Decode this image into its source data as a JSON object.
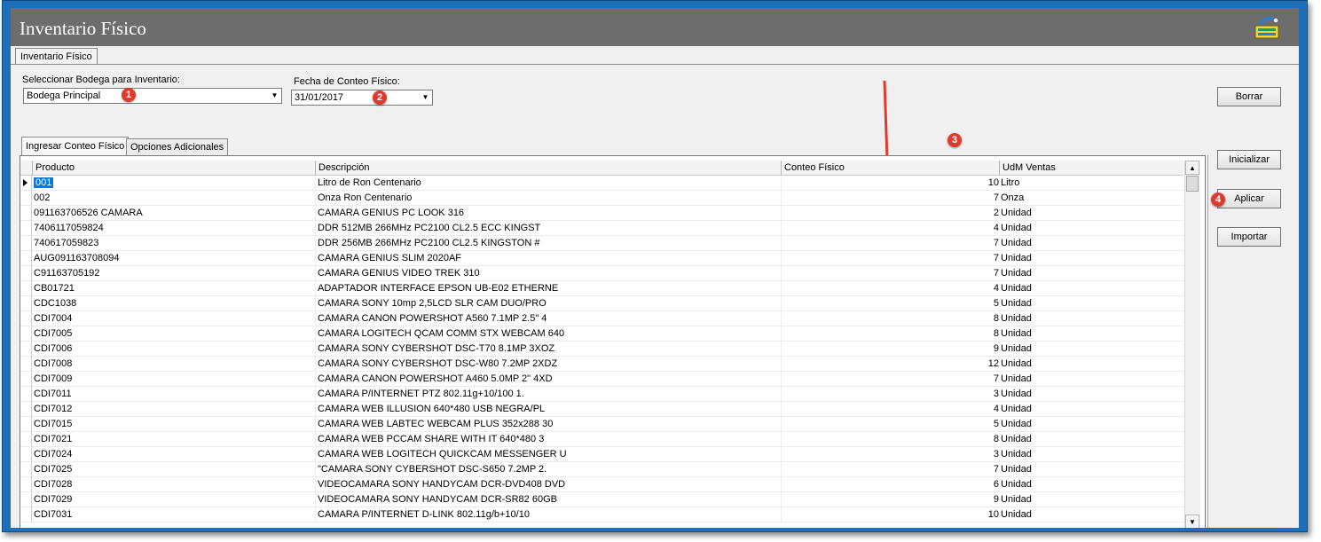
{
  "window": {
    "title": "Inventario Físico"
  },
  "top_tab": {
    "label": "Inventario Físico"
  },
  "warehouse": {
    "label": "Seleccionar Bodega para Inventario:",
    "value": "Bodega Principal"
  },
  "count_date": {
    "label": "Fecha de Conteo Físico:",
    "value": "31/01/2017"
  },
  "buttons": {
    "borrar": "Borrar",
    "inicializar": "Inicializar",
    "aplicar": "Aplicar",
    "importar": "Importar"
  },
  "sub_tabs": [
    {
      "label": "Ingresar Conteo Físico"
    },
    {
      "label": "Opciones Adicionales"
    }
  ],
  "badges": {
    "b1": "1",
    "b2": "2",
    "b3": "3",
    "b4": "4"
  },
  "grid": {
    "columns": {
      "producto": "Producto",
      "descripcion": "Descripción",
      "conteo": "Conteo Físico",
      "udm": "UdM Ventas"
    },
    "rows": [
      {
        "producto": "001",
        "descripcion": "Litro de Ron Centenario",
        "conteo": "10",
        "udm": "Litro"
      },
      {
        "producto": "002",
        "descripcion": "Onza Ron Centenario",
        "conteo": "7",
        "udm": "Onza"
      },
      {
        "producto": "091163706526 CAMARA",
        "descripcion": "CAMARA GENIUS PC LOOK 316",
        "conteo": "2",
        "udm": "Unidad"
      },
      {
        "producto": "7406117059824",
        "descripcion": "DDR 512MB 266MHz PC2100 CL2.5 ECC KINGST",
        "conteo": "4",
        "udm": "Unidad"
      },
      {
        "producto": "740617059823",
        "descripcion": "DDR 256MB 266MHz PC2100 CL2.5 KINGSTON #",
        "conteo": "7",
        "udm": "Unidad"
      },
      {
        "producto": "AUG091163708094",
        "descripcion": "CAMARA GENIUS SLIM 2020AF",
        "conteo": "7",
        "udm": "Unidad"
      },
      {
        "producto": "C91163705192",
        "descripcion": "CAMARA GENIUS VIDEO TREK 310",
        "conteo": "7",
        "udm": "Unidad"
      },
      {
        "producto": "CB01721",
        "descripcion": "ADAPTADOR INTERFACE EPSON UB-E02 ETHERNE",
        "conteo": "4",
        "udm": "Unidad"
      },
      {
        "producto": "CDC1038",
        "descripcion": "CAMARA SONY 10mp 2,5LCD SLR CAM DUO/PRO",
        "conteo": "5",
        "udm": "Unidad"
      },
      {
        "producto": "CDI7004",
        "descripcion": "CAMARA CANON POWERSHOT A560 7.1MP 2.5\" 4",
        "conteo": "8",
        "udm": "Unidad"
      },
      {
        "producto": "CDI7005",
        "descripcion": "CAMARA LOGITECH QCAM COMM STX WEBCAM 640",
        "conteo": "8",
        "udm": "Unidad"
      },
      {
        "producto": "CDI7006",
        "descripcion": "CAMARA SONY CYBERSHOT DSC-T70 8.1MP 3XOZ",
        "conteo": "9",
        "udm": "Unidad"
      },
      {
        "producto": "CDI7008",
        "descripcion": "CAMARA SONY CYBERSHOT DSC-W80 7.2MP 2XDZ",
        "conteo": "12",
        "udm": "Unidad"
      },
      {
        "producto": "CDI7009",
        "descripcion": "CAMARA CANON POWERSHOT A460 5.0MP 2\" 4XD",
        "conteo": "7",
        "udm": "Unidad"
      },
      {
        "producto": "CDI7011",
        "descripcion": "CAMARA P/INTERNET PTZ  802.11g+10/100 1.",
        "conteo": "3",
        "udm": "Unidad"
      },
      {
        "producto": "CDI7012",
        "descripcion": "CAMARA WEB ILLUSION 640*480 USB NEGRA/PL",
        "conteo": "4",
        "udm": "Unidad"
      },
      {
        "producto": "CDI7015",
        "descripcion": "CAMARA WEB LABTEC WEBCAM PLUS 352x288 30",
        "conteo": "5",
        "udm": "Unidad"
      },
      {
        "producto": "CDI7021",
        "descripcion": "CAMARA WEB PCCAM SHARE WITH IT 640*480 3",
        "conteo": "8",
        "udm": "Unidad"
      },
      {
        "producto": "CDI7024",
        "descripcion": "CAMARA WEB LOGITECH QUICKCAM MESSENGER U",
        "conteo": "3",
        "udm": "Unidad"
      },
      {
        "producto": "CDI7025",
        "descripcion": "\"CAMARA SONY CYBERSHOT DSC-S650 7.2MP 2.",
        "conteo": "7",
        "udm": "Unidad"
      },
      {
        "producto": "CDI7028",
        "descripcion": "VIDEOCAMARA SONY HANDYCAM DCR-DVD408 DVD",
        "conteo": "6",
        "udm": "Unidad"
      },
      {
        "producto": "CDI7029",
        "descripcion": "VIDEOCAMARA SONY HANDYCAM DCR-SR82 60GB",
        "conteo": "9",
        "udm": "Unidad"
      },
      {
        "producto": "CDI7031",
        "descripcion": "CAMARA P/INTERNET D-LINK 802.11g/b+10/10",
        "conteo": "10",
        "udm": "Unidad"
      }
    ]
  },
  "colors": {
    "annotation_red": "#e03a2f",
    "title_bar": "#6d6d6d",
    "selection_blue": "#0a7ad6",
    "frame_blue": "#1e6fb8"
  }
}
